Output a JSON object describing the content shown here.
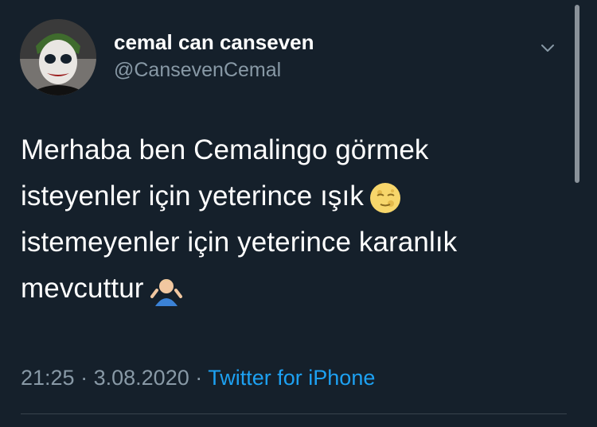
{
  "user": {
    "display_name": "cemal can canseven",
    "handle": "@CansevenCemal"
  },
  "tweet": {
    "lines": [
      "Merhaba ben Cemalingo görmek",
      "isteyenler için yeterince ışık",
      "istemeyenler için yeterince karanlık",
      "mevcuttur"
    ],
    "emojis": [
      "moon-face-emoji",
      "shrug-emoji"
    ]
  },
  "meta": {
    "time": "21:25",
    "separator": "·",
    "date": "3.08.2020",
    "source": "Twitter for iPhone"
  },
  "colors": {
    "background": "#15202b",
    "secondary_text": "#8899a6",
    "link": "#1da1f2"
  }
}
